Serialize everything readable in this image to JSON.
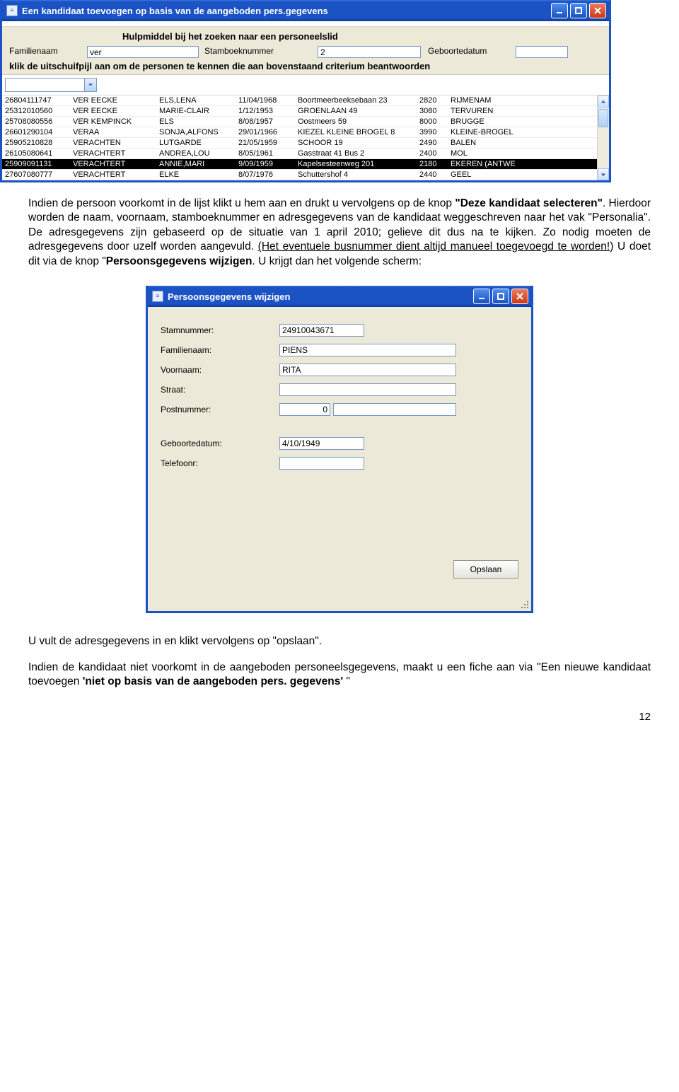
{
  "win1": {
    "title": "Een kandidaat toevoegen op basis van de aangeboden pers.gegevens",
    "search_title": "Hulpmiddel bij het zoeken naar een personeelslid",
    "filters": {
      "familienaam_label": "Familienaam",
      "familienaam_value": "ver",
      "stamboek_label": "Stamboeknummer",
      "stamboek_value": "2",
      "geboorte_label": "Geboortedatum",
      "geboorte_value": ""
    },
    "instruction": "klik de uitschuifpijl aan om de personen te kennen die aan bovenstaand criterium beantwoorden",
    "rows": [
      {
        "id": "26804111747",
        "ln": "VER EECKE",
        "fn": "ELS,LENA",
        "bd": "11/04/1968",
        "ad": "Boortmeerbeeksebaan 23",
        "pc": "2820",
        "ct": "RIJMENAM"
      },
      {
        "id": "25312010560",
        "ln": "VER EECKE",
        "fn": "MARIE-CLAIR",
        "bd": "1/12/1953",
        "ad": "GROENLAAN 49",
        "pc": "3080",
        "ct": "TERVUREN"
      },
      {
        "id": "25708080556",
        "ln": "VER KEMPINCK",
        "fn": "ELS",
        "bd": "8/08/1957",
        "ad": "Oostmeers 59",
        "pc": "8000",
        "ct": "BRUGGE"
      },
      {
        "id": "26601290104",
        "ln": "VERAA",
        "fn": "SONJA,ALFONS",
        "bd": "29/01/1966",
        "ad": "KIEZEL KLEINE BROGEL 8",
        "pc": "3990",
        "ct": "KLEINE-BROGEL"
      },
      {
        "id": "25905210828",
        "ln": "VERACHTEN",
        "fn": "LUTGARDE",
        "bd": "21/05/1959",
        "ad": "SCHOOR 19",
        "pc": "2490",
        "ct": "BALEN"
      },
      {
        "id": "26105080641",
        "ln": "VERACHTERT",
        "fn": "ANDREA,LOU",
        "bd": "8/05/1961",
        "ad": "Gasstraat 41 Bus 2",
        "pc": "2400",
        "ct": "MOL"
      },
      {
        "id": "25909091131",
        "ln": "VERACHTERT",
        "fn": "ANNIE,MARI",
        "bd": "9/09/1959",
        "ad": "Kapelsesteenweg 201",
        "pc": "2180",
        "ct": "EKEREN (ANTWE"
      },
      {
        "id": "27607080777",
        "ln": "VERACHTERT",
        "fn": "ELKE",
        "bd": "8/07/1976",
        "ad": "Schuttershof 4",
        "pc": "2440",
        "ct": "GEEL"
      }
    ],
    "selected_index": 6
  },
  "para1": {
    "t1": "Indien de persoon voorkomt in de lijst klikt u hem aan en drukt u vervolgens op de knop ",
    "b1": "\"Deze kandidaat selecteren\"",
    "t2": ". Hierdoor worden de naam, voornaam, stamboeknummer en adresgegevens van de kandidaat weggeschreven naar het vak \"Personalia\". De adresgegevens zijn gebaseerd op de situatie van 1 april 2010; gelieve dit dus na te kijken. Zo nodig moeten de adresgegevens door uzelf worden aangevuld. ",
    "u1": "(Het eventuele busnummer dient altijd manueel toegevoegd te worden!",
    "t3": ") U doet dit via de knop \"",
    "b2": "Persoonsgegevens wijzigen",
    "t4": ". U krijgt dan het volgende scherm:"
  },
  "win2": {
    "title": "Persoonsgegevens wijzigen",
    "labels": {
      "stam": "Stamnummer:",
      "fam": "Familienaam:",
      "vn": "Voornaam:",
      "str": "Straat:",
      "pn": "Postnummer:",
      "gd": "Geboortedatum:",
      "tel": "Telefoonr:"
    },
    "values": {
      "stam": "24910043671",
      "fam": "PIENS",
      "vn": "RITA",
      "str": "",
      "pn": "0",
      "pc2": "",
      "gd": "4/10/1949",
      "tel": ""
    },
    "save_label": "Opslaan"
  },
  "para2": {
    "t1": "U vult de adresgegevens in en klikt vervolgens op \"opslaan\".",
    "t2a": "Indien de kandidaat niet voorkomt in de aangeboden personeelsgegevens, maakt u een fiche aan via \"Een nieuwe kandidaat toevoegen ",
    "b1": "'niet op basis van de aangeboden pers. gegevens' ",
    "t2b": "\""
  },
  "page_number": "12"
}
